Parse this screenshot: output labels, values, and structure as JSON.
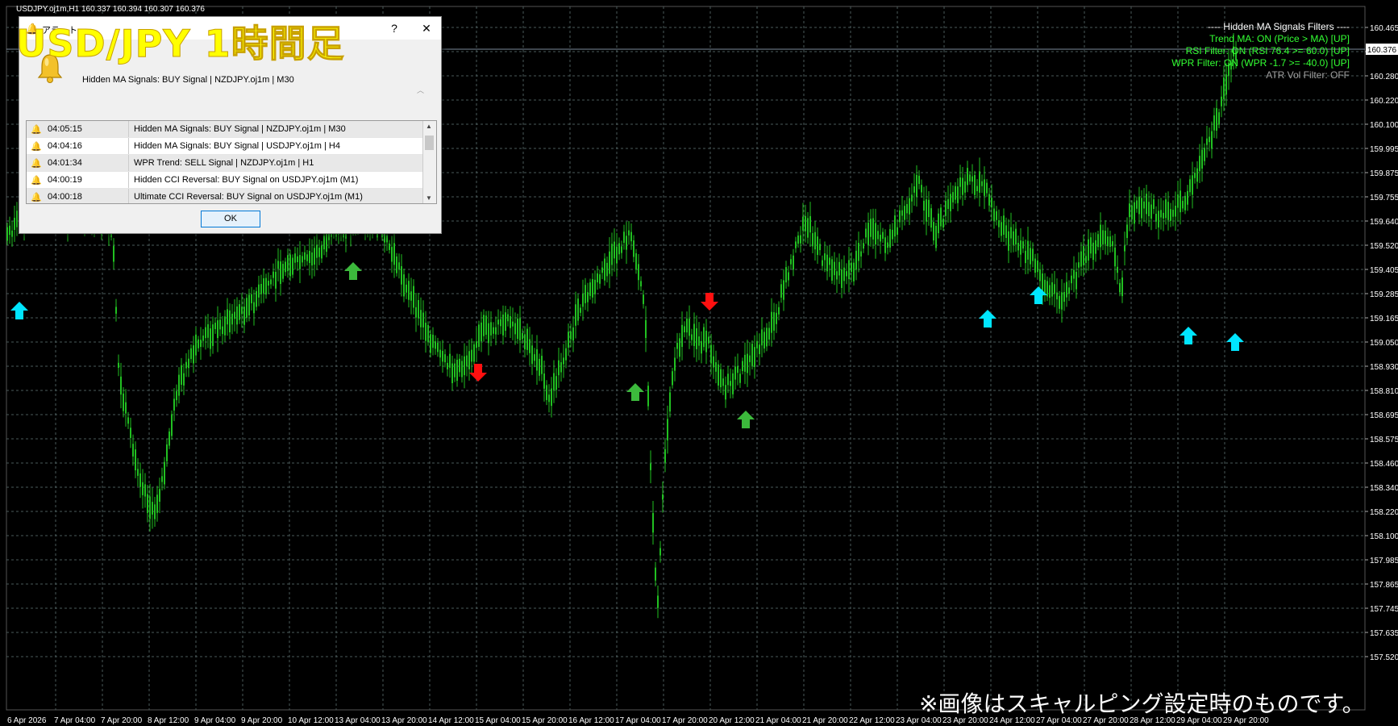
{
  "overlay": {
    "title": "USD/JPY 1時間足",
    "note": "※画像はスキャルピング設定時のものです。"
  },
  "chart": {
    "symbol_label": "USDJPY.oj1m,H1  160.337 160.394 160.307 160.376",
    "current_price_label": "160.376",
    "price_axis": [
      "160.465",
      "160.405",
      "160.280",
      "160.220",
      "160.100",
      "159.995",
      "159.875",
      "159.755",
      "159.640",
      "159.520",
      "159.405",
      "159.285",
      "159.165",
      "159.050",
      "158.930",
      "158.810",
      "158.695",
      "158.575",
      "158.460",
      "158.340",
      "158.220",
      "158.100",
      "157.985",
      "157.865",
      "157.745",
      "157.635",
      "157.520"
    ],
    "time_axis": [
      "6 Apr 2026",
      "7 Apr 04:00",
      "7 Apr 20:00",
      "8 Apr 12:00",
      "9 Apr 04:00",
      "9 Apr 20:00",
      "10 Apr 12:00",
      "13 Apr 04:00",
      "13 Apr 20:00",
      "14 Apr 12:00",
      "15 Apr 04:00",
      "15 Apr 20:00",
      "16 Apr 12:00",
      "17 Apr 04:00",
      "17 Apr 20:00",
      "20 Apr 12:00",
      "21 Apr 04:00",
      "21 Apr 20:00",
      "22 Apr 12:00",
      "23 Apr 04:00",
      "23 Apr 20:00",
      "24 Apr 12:00",
      "27 Apr 04:00",
      "27 Apr 20:00",
      "28 Apr 12:00",
      "29 Apr 04:00",
      "29 Apr 20:00"
    ],
    "colors": {
      "background": "#000000",
      "grid": "#4a5a5a",
      "candle": "#21c021",
      "buy_arrow_green": "#3cb93c",
      "buy_arrow_cyan": "#00e5ff",
      "sell_arrow": "#ff1010",
      "axis_text": "#ffffff"
    }
  },
  "filters": {
    "title": "---- Hidden MA Signals Filters ----",
    "lines": [
      {
        "text": "Trend MA: ON (Price > MA) [UP]",
        "color": "#33ff33"
      },
      {
        "text": "RSI Filter: ON (RSI 76.4 >= 60.0) [UP]",
        "color": "#33ff33"
      },
      {
        "text": "WPR Filter: ON (WPR -1.7 >= -40.0) [UP]",
        "color": "#33ff33"
      },
      {
        "text": "ATR Vol Filter: OFF",
        "color": "#a0a0a0"
      }
    ]
  },
  "alert_dialog": {
    "title": "アラート",
    "help_label": "?",
    "close_label": "✕",
    "bell_icon": "bell-icon",
    "message": "Hidden MA Signals: BUY Signal | NZDJPY.oj1m | M30",
    "rows": [
      {
        "time": "04:05:15",
        "message": "Hidden MA Signals: BUY Signal | NZDJPY.oj1m | M30"
      },
      {
        "time": "04:04:16",
        "message": "Hidden MA Signals: BUY Signal | USDJPY.oj1m | H4"
      },
      {
        "time": "04:01:34",
        "message": "WPR Trend: SELL Signal | NZDJPY.oj1m | H1"
      },
      {
        "time": "04:00:19",
        "message": "Hidden CCI Reversal: BUY Signal on USDJPY.oj1m (M1)"
      },
      {
        "time": "04:00:18",
        "message": "Ultimate CCI Reversal: BUY Signal on USDJPY.oj1m (M1)"
      }
    ],
    "ok_label": "OK"
  }
}
